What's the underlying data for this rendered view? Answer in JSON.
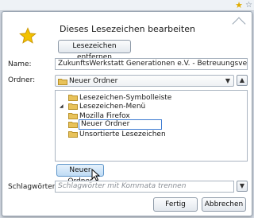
{
  "dialog": {
    "title": "Dieses Lesezeichen bearbeiten",
    "remove_button": "Lesezeichen entfernen",
    "name_label": "Name:",
    "name_value": "ZukunftsWerkstatt Generationen e.V. - Betreuungsverein War",
    "folder_label": "Ordner:",
    "folder_selected": "Neuer Ordner",
    "tree": [
      {
        "label": "Lesezeichen-Symbolleiste"
      },
      {
        "label": "Lesezeichen-Menü"
      },
      {
        "label": "Mozilla Firefox"
      },
      {
        "label": "Neuer Ordner"
      },
      {
        "label": "Unsortierte Lesezeichen"
      }
    ],
    "new_folder_button": "Neuer Ordner",
    "tags_label": "Schlagwörter:",
    "tags_placeholder": "Schlagwörter mit Kommata trennen",
    "done_button": "Fertig",
    "cancel_button": "Abbrechen"
  },
  "colors": {
    "star": "#f2c200",
    "folder": "#e8c25a",
    "selection_border": "#3d7bd1",
    "new_folder_button": "#bfdcf5"
  },
  "icons": [
    "bookmark-star-icon",
    "folder-icon",
    "dropdown-arrow-icon",
    "collapse-arrow-icon",
    "mouse-cursor-icon"
  ]
}
